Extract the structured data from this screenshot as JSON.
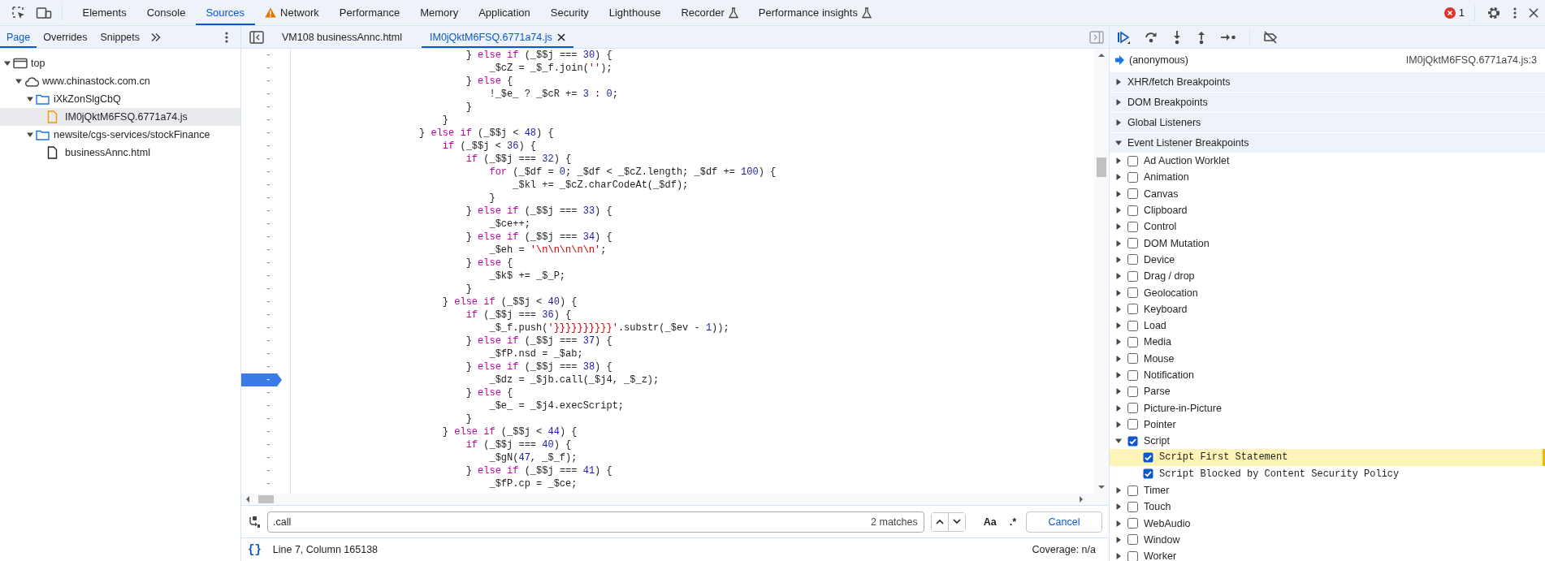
{
  "main_tabs": [
    {
      "label": "Elements",
      "selected": false,
      "kind": "plain"
    },
    {
      "label": "Console",
      "selected": false,
      "kind": "plain"
    },
    {
      "label": "Sources",
      "selected": true,
      "kind": "plain"
    },
    {
      "label": "Network",
      "selected": false,
      "kind": "warning"
    },
    {
      "label": "Performance",
      "selected": false,
      "kind": "plain"
    },
    {
      "label": "Memory",
      "selected": false,
      "kind": "plain"
    },
    {
      "label": "Application",
      "selected": false,
      "kind": "plain"
    },
    {
      "label": "Security",
      "selected": false,
      "kind": "plain"
    },
    {
      "label": "Lighthouse",
      "selected": false,
      "kind": "plain"
    },
    {
      "label": "Recorder",
      "selected": false,
      "kind": "experimental"
    },
    {
      "label": "Performance insights",
      "selected": false,
      "kind": "experimental"
    }
  ],
  "error_count": "1",
  "navigator": {
    "tabs": [
      {
        "label": "Page",
        "selected": true
      },
      {
        "label": "Overrides",
        "selected": false
      },
      {
        "label": "Snippets",
        "selected": false
      }
    ],
    "tree": [
      {
        "label": "top",
        "kind": "frame",
        "expanded": true,
        "selected": false,
        "children": [
          {
            "label": "www.chinastock.com.cn",
            "kind": "domain",
            "expanded": true,
            "selected": false,
            "children": [
              {
                "label": "iXkZonSlgCbQ",
                "kind": "folder",
                "expanded": true,
                "selected": false,
                "children": [
                  {
                    "label": "IM0jQktM6FSQ.6771a74.js",
                    "kind": "script",
                    "selected": true
                  }
                ]
              },
              {
                "label": "newsite/cgs-services/stockFinance",
                "kind": "folder",
                "expanded": true,
                "selected": false,
                "children": [
                  {
                    "label": "businessAnnc.html",
                    "kind": "document",
                    "selected": false
                  }
                ]
              }
            ]
          }
        ]
      }
    ]
  },
  "editor": {
    "tabs": [
      {
        "label": "VM108 businessAnnc.html",
        "selected": false,
        "closable": false
      },
      {
        "label": "IM0jQktM6FSQ.6771a74.js",
        "selected": true,
        "closable": true
      }
    ],
    "lines": [
      {
        "marker": "-",
        "text": "                            } else if (_$$j === 30) {",
        "breakpoint": false
      },
      {
        "marker": "-",
        "text": "                                _$cZ = _$_f.join('');",
        "breakpoint": false
      },
      {
        "marker": "-",
        "text": "                            } else {",
        "breakpoint": false
      },
      {
        "marker": "-",
        "text": "                                !_$e_ ? _$cR += 3 : 0;",
        "breakpoint": false
      },
      {
        "marker": "-",
        "text": "                            }",
        "breakpoint": false
      },
      {
        "marker": "-",
        "text": "                        }",
        "breakpoint": false
      },
      {
        "marker": "-",
        "text": "                    } else if (_$$j < 48) {",
        "breakpoint": false
      },
      {
        "marker": "-",
        "text": "                        if (_$$j < 36) {",
        "breakpoint": false
      },
      {
        "marker": "-",
        "text": "                            if (_$$j === 32) {",
        "breakpoint": false
      },
      {
        "marker": "-",
        "text": "                                for (_$df = 0; _$df < _$cZ.length; _$df += 100) {",
        "breakpoint": false
      },
      {
        "marker": "-",
        "text": "                                    _$kl += _$cZ.charCodeAt(_$df);",
        "breakpoint": false
      },
      {
        "marker": "-",
        "text": "                                }",
        "breakpoint": false
      },
      {
        "marker": "-",
        "text": "                            } else if (_$$j === 33) {",
        "breakpoint": false
      },
      {
        "marker": "-",
        "text": "                                _$ce++;",
        "breakpoint": false
      },
      {
        "marker": "-",
        "text": "                            } else if (_$$j === 34) {",
        "breakpoint": false
      },
      {
        "marker": "-",
        "text": "                                _$eh = '\\n\\n\\n\\n\\n';",
        "breakpoint": false
      },
      {
        "marker": "-",
        "text": "                            } else {",
        "breakpoint": false
      },
      {
        "marker": "-",
        "text": "                                _$k$ += _$_P;",
        "breakpoint": false
      },
      {
        "marker": "-",
        "text": "                            }",
        "breakpoint": false
      },
      {
        "marker": "-",
        "text": "                        } else if (_$$j < 40) {",
        "breakpoint": false
      },
      {
        "marker": "-",
        "text": "                            if (_$$j === 36) {",
        "breakpoint": false
      },
      {
        "marker": "-",
        "text": "                                _$_f.push('}}}}}}}}}}'.substr(_$ev - 1));",
        "breakpoint": false
      },
      {
        "marker": "-",
        "text": "                            } else if (_$$j === 37) {",
        "breakpoint": false
      },
      {
        "marker": "-",
        "text": "                                _$fP.nsd = _$ab;",
        "breakpoint": false
      },
      {
        "marker": "-",
        "text": "                            } else if (_$$j === 38) {",
        "breakpoint": false
      },
      {
        "marker": "-",
        "text": "                                _$dz = _$jb.call(_$j4, _$_z);",
        "breakpoint": true
      },
      {
        "marker": "-",
        "text": "                            } else {",
        "breakpoint": false
      },
      {
        "marker": "-",
        "text": "                                _$e_ = _$j4.execScript;",
        "breakpoint": false
      },
      {
        "marker": "-",
        "text": "                            }",
        "breakpoint": false
      },
      {
        "marker": "-",
        "text": "                        } else if (_$$j < 44) {",
        "breakpoint": false
      },
      {
        "marker": "-",
        "text": "                            if (_$$j === 40) {",
        "breakpoint": false
      },
      {
        "marker": "-",
        "text": "                                _$gN(47, _$_f);",
        "breakpoint": false
      },
      {
        "marker": "-",
        "text": "                            } else if (_$$j === 41) {",
        "breakpoint": false
      },
      {
        "marker": "-",
        "text": "                                _$fP.cp = _$ce;",
        "breakpoint": false
      }
    ],
    "search": {
      "value": ".call",
      "matches": "2 matches",
      "case_label": "Aa",
      "regex_label": ".*",
      "cancel_label": "Cancel"
    },
    "status": {
      "format_label": "{}",
      "position": "Line 7, Column 165138",
      "coverage": "Coverage: n/a"
    }
  },
  "debugger": {
    "call_frame": {
      "name": "(anonymous)",
      "location": "IM0jQktM6FSQ.6771a74.js:3"
    },
    "sections": [
      {
        "label": "XHR/fetch Breakpoints",
        "expanded": false
      },
      {
        "label": "DOM Breakpoints",
        "expanded": false
      },
      {
        "label": "Global Listeners",
        "expanded": false
      },
      {
        "label": "Event Listener Breakpoints",
        "expanded": true
      }
    ],
    "event_categories": [
      {
        "label": "Ad Auction Worklet",
        "checked": false,
        "expanded": false
      },
      {
        "label": "Animation",
        "checked": false,
        "expanded": false
      },
      {
        "label": "Canvas",
        "checked": false,
        "expanded": false
      },
      {
        "label": "Clipboard",
        "checked": false,
        "expanded": false
      },
      {
        "label": "Control",
        "checked": false,
        "expanded": false
      },
      {
        "label": "DOM Mutation",
        "checked": false,
        "expanded": false
      },
      {
        "label": "Device",
        "checked": false,
        "expanded": false
      },
      {
        "label": "Drag / drop",
        "checked": false,
        "expanded": false
      },
      {
        "label": "Geolocation",
        "checked": false,
        "expanded": false
      },
      {
        "label": "Keyboard",
        "checked": false,
        "expanded": false
      },
      {
        "label": "Load",
        "checked": false,
        "expanded": false
      },
      {
        "label": "Media",
        "checked": false,
        "expanded": false
      },
      {
        "label": "Mouse",
        "checked": false,
        "expanded": false
      },
      {
        "label": "Notification",
        "checked": false,
        "expanded": false
      },
      {
        "label": "Parse",
        "checked": false,
        "expanded": false
      },
      {
        "label": "Picture-in-Picture",
        "checked": false,
        "expanded": false
      },
      {
        "label": "Pointer",
        "checked": false,
        "expanded": false
      },
      {
        "label": "Script",
        "checked": true,
        "expanded": true,
        "children": [
          {
            "label": "Script First Statement",
            "checked": true,
            "selected": true
          },
          {
            "label": "Script Blocked by Content Security Policy",
            "checked": true,
            "selected": false
          }
        ]
      },
      {
        "label": "Timer",
        "checked": false,
        "expanded": false
      },
      {
        "label": "Touch",
        "checked": false,
        "expanded": false
      },
      {
        "label": "WebAudio",
        "checked": false,
        "expanded": false
      },
      {
        "label": "Window",
        "checked": false,
        "expanded": false
      },
      {
        "label": "Worker",
        "checked": false,
        "expanded": false
      }
    ]
  }
}
